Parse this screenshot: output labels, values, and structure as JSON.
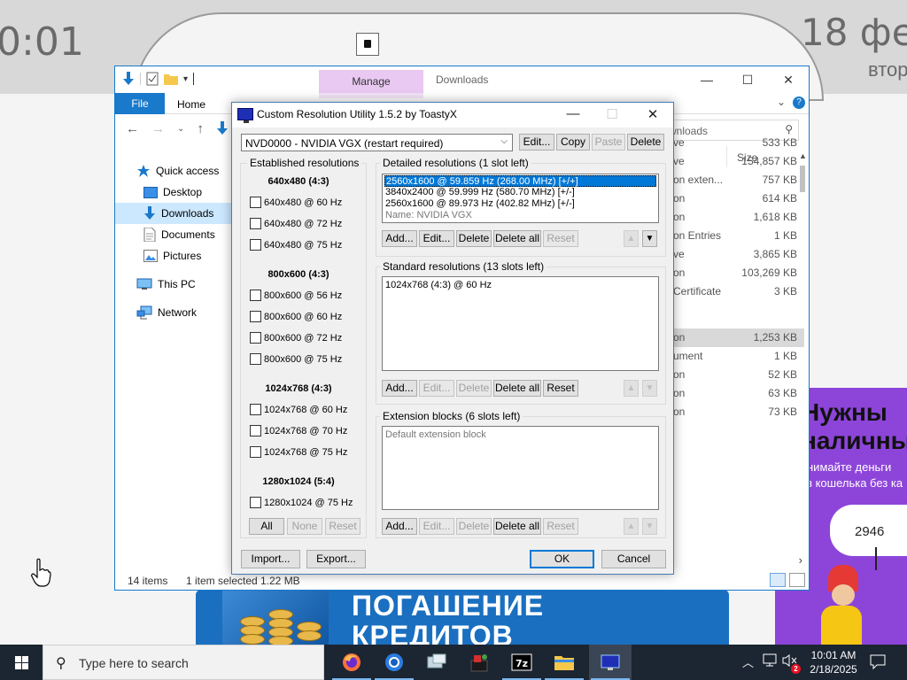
{
  "background": {
    "clock": "0:01",
    "date": "18 фе",
    "weekday": "втор",
    "banner_line1": "ПОГАШЕНИЕ",
    "banner_line2": "КРЕДИТОВ",
    "ad_line1": "Нужны",
    "ad_line2": "наличны",
    "ad_sub1": "нимайте деньги",
    "ad_sub2": "з кошелька без ка",
    "ad_number": "2946"
  },
  "explorer": {
    "title": "Downloads",
    "manage_tab": "Manage",
    "file_tab": "File",
    "home_tab": "Home",
    "search_placeholder": "Search Downloads",
    "search_visible": "wnloads",
    "size_header": "Size",
    "sidebar": [
      {
        "label": "Quick access",
        "icon": "star-icon"
      },
      {
        "label": "Desktop",
        "icon": "desktop-icon"
      },
      {
        "label": "Downloads",
        "icon": "download-icon"
      },
      {
        "label": "Documents",
        "icon": "documents-icon"
      },
      {
        "label": "Pictures",
        "icon": "pictures-icon"
      },
      {
        "label": "This PC",
        "icon": "computer-icon"
      },
      {
        "label": "Network",
        "icon": "network-icon"
      }
    ],
    "rows": [
      {
        "type": "ve",
        "size": "533 KB"
      },
      {
        "type": "ve",
        "size": "154,857 KB"
      },
      {
        "type": "on exten...",
        "size": "757 KB"
      },
      {
        "type": "on",
        "size": "614 KB"
      },
      {
        "type": "on",
        "size": "1,618 KB"
      },
      {
        "type": "on Entries",
        "size": "1 KB"
      },
      {
        "type": "ve",
        "size": "3,865 KB"
      },
      {
        "type": "on",
        "size": "103,269 KB"
      },
      {
        "type": "Certificate",
        "size": "3 KB"
      },
      {
        "type": "on",
        "size": "1,253 KB"
      },
      {
        "type": "ument",
        "size": "1 KB"
      },
      {
        "type": "on",
        "size": "52 KB"
      },
      {
        "type": "on",
        "size": "63 KB"
      },
      {
        "type": "on",
        "size": "73 KB"
      }
    ],
    "status_items": "14 items",
    "status_selected": "1 item selected",
    "status_size": "1.22 MB"
  },
  "dialog": {
    "title": "Custom Resolution Utility 1.5.2 by ToastyX",
    "device": "NVD0000 - NVIDIA VGX  (restart required)",
    "top_buttons": {
      "edit": "Edit...",
      "copy": "Copy",
      "paste": "Paste",
      "delete": "Delete"
    },
    "established": {
      "label": "Established resolutions",
      "groups": [
        {
          "heading": "640x480 (4:3)",
          "items": [
            "640x480 @ 60 Hz",
            "640x480 @ 72 Hz",
            "640x480 @ 75 Hz"
          ]
        },
        {
          "heading": "800x600 (4:3)",
          "items": [
            "800x600 @ 56 Hz",
            "800x600 @ 60 Hz",
            "800x600 @ 72 Hz",
            "800x600 @ 75 Hz"
          ]
        },
        {
          "heading": "1024x768 (4:3)",
          "items": [
            "1024x768 @ 60 Hz",
            "1024x768 @ 70 Hz",
            "1024x768 @ 75 Hz"
          ]
        },
        {
          "heading": "1280x1024 (5:4)",
          "items": [
            "1280x1024 @ 75 Hz"
          ]
        }
      ],
      "buttons": {
        "all": "All",
        "none": "None",
        "reset": "Reset"
      }
    },
    "detailed": {
      "label": "Detailed resolutions (1 slot left)",
      "items": [
        "2560x1600 @ 59.859 Hz (268.00 MHz) [+/+]",
        "3840x2400 @ 59.999 Hz (580.70 MHz) [+/-]",
        "2560x1600 @ 89.973 Hz (402.82 MHz) [+/-]"
      ],
      "name_line": "Name: NVIDIA VGX"
    },
    "standard": {
      "label": "Standard resolutions (13 slots left)",
      "items": [
        "1024x768 (4:3) @ 60 Hz"
      ]
    },
    "extension": {
      "label": "Extension blocks (6 slots left)",
      "items": [
        "Default extension block"
      ]
    },
    "list_buttons": {
      "add": "Add...",
      "edit": "Edit...",
      "delete": "Delete",
      "delete_all": "Delete all",
      "reset": "Reset"
    },
    "import": "Import...",
    "export": "Export...",
    "ok": "OK",
    "cancel": "Cancel"
  },
  "taskbar": {
    "search_placeholder": "Type here to search",
    "time": "10:01 AM",
    "date": "2/18/2025",
    "notification_count": "2"
  }
}
